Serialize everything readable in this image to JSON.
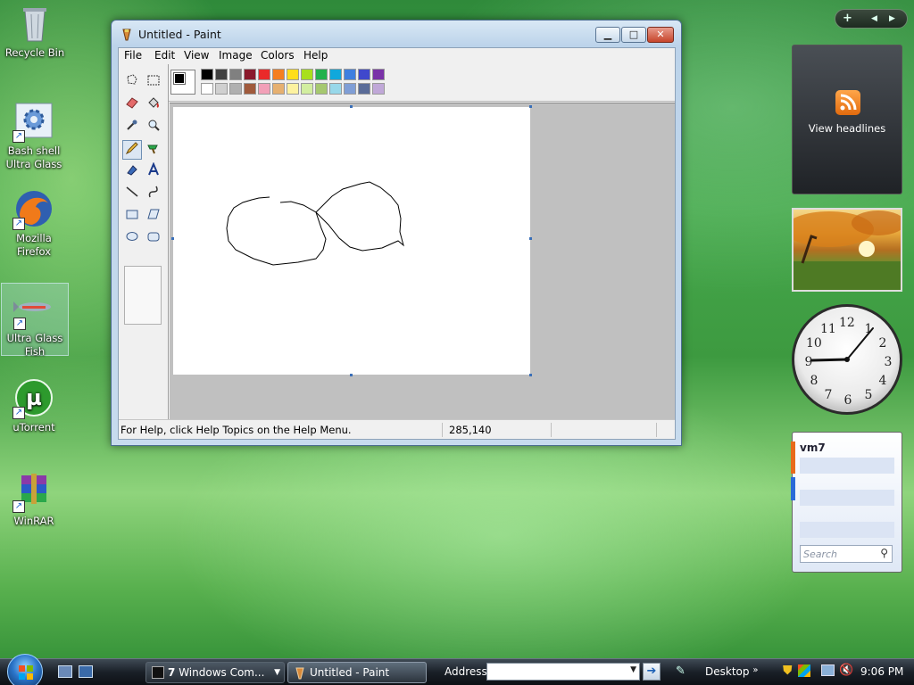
{
  "desktop": {
    "icons": [
      {
        "label": "Recycle Bin"
      },
      {
        "label": "Bash shell Ultra Glass"
      },
      {
        "label": "Mozilla Firefox"
      },
      {
        "label": "Ultra Glass Fish"
      },
      {
        "label": "uTorrent"
      },
      {
        "label": "WinRAR"
      }
    ]
  },
  "window": {
    "title": "Untitled - Paint",
    "menu": [
      "File",
      "Edit",
      "View",
      "Image",
      "Colors",
      "Help"
    ],
    "palette": {
      "top_row": [
        "#000000",
        "#404040",
        "#808080",
        "#8b1a2c",
        "#ea2a2a",
        "#f57f20",
        "#ffde1a",
        "#a8e01c",
        "#22b14c",
        "#10a8dc",
        "#3f7fe0",
        "#3f48cc",
        "#7a32a8"
      ],
      "bottom_row": [
        "#ffffff",
        "#d0d0d0",
        "#b0b0b0",
        "#a05a3c",
        "#f2a0b8",
        "#e6b070",
        "#fdf2a0",
        "#d2eea0",
        "#a6c870",
        "#98d8ea",
        "#7f9ed6",
        "#5a6c98",
        "#c0a8d8"
      ]
    },
    "status_help": "For Help, click Help Topics on the Help Menu.",
    "status_coords": "285,140"
  },
  "sidebar": {
    "feed_label": "View headlines",
    "clock_numbers": [
      "12",
      "1",
      "2",
      "3",
      "4",
      "5",
      "6",
      "7",
      "8",
      "9",
      "10",
      "11"
    ],
    "notes_title": "vm7",
    "notes_search_placeholder": "Search"
  },
  "taskbar": {
    "windows_command": "Windows Com...",
    "windows_command_count": "7",
    "paint": "Untitled - Paint",
    "address_label": "Address",
    "desktop_label": "Desktop",
    "time": "9:06 PM"
  }
}
